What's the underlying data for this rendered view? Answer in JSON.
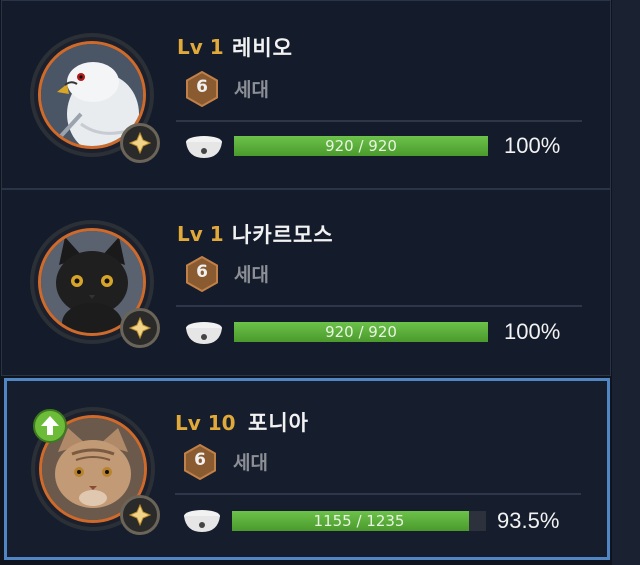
{
  "pets": [
    {
      "level": "Lv 1",
      "name": "레비오",
      "generation_number": "6",
      "generation_label": "세대",
      "hunger_text": "920 / 920",
      "hunger_fill": 1.0,
      "percent": "100%",
      "animal": "hawk-icon",
      "selected": false
    },
    {
      "level": "Lv 1",
      "name": "나카르모스",
      "generation_number": "6",
      "generation_label": "세대",
      "hunger_text": "920 / 920",
      "hunger_fill": 1.0,
      "percent": "100%",
      "animal": "black-cat-icon",
      "selected": false
    },
    {
      "level": "Lv 10",
      "name": "포니아",
      "generation_number": "6",
      "generation_label": "세대",
      "hunger_text": "1155 / 1235",
      "hunger_fill": 0.935,
      "percent": "93.5%",
      "animal": "tabby-cat-icon",
      "selected": true
    }
  ],
  "colors": {
    "level": "#e0a93a",
    "ring": "#d06a2a",
    "selected_border": "#4f86c3",
    "bar_fill": "#5aae38"
  }
}
